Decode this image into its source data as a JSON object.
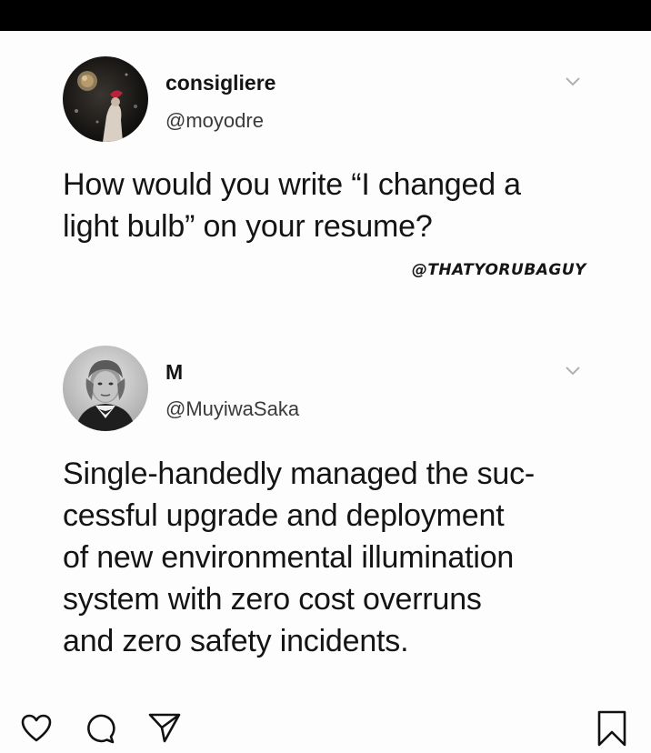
{
  "tweet1": {
    "display_name": "consigliere",
    "handle": "@moyodre",
    "text": "How would you write “I changed a\nlight bulb” on your resume?",
    "avatar_icon": "avatar-dark-art-icon",
    "more_icon": "chevron-down-icon"
  },
  "watermark": "@THATYORUBAGUY",
  "tweet2": {
    "display_name": "M",
    "handle": "@MuyiwaSaka",
    "text": "Single-handedly managed the suc-\ncessful upgrade and deployment\nof new environmental illumination\nsystem with zero cost overruns\nand zero safety incidents.",
    "avatar_icon": "avatar-portrait-icon",
    "more_icon": "chevron-down-icon"
  },
  "actions": {
    "like_icon": "heart-icon",
    "comment_icon": "comment-icon",
    "share_icon": "send-icon",
    "save_icon": "bookmark-icon"
  },
  "colors": {
    "top_bar": "#000000",
    "background": "#fdfdfd",
    "text": "#141414",
    "chevron": "#b0b0b0"
  }
}
